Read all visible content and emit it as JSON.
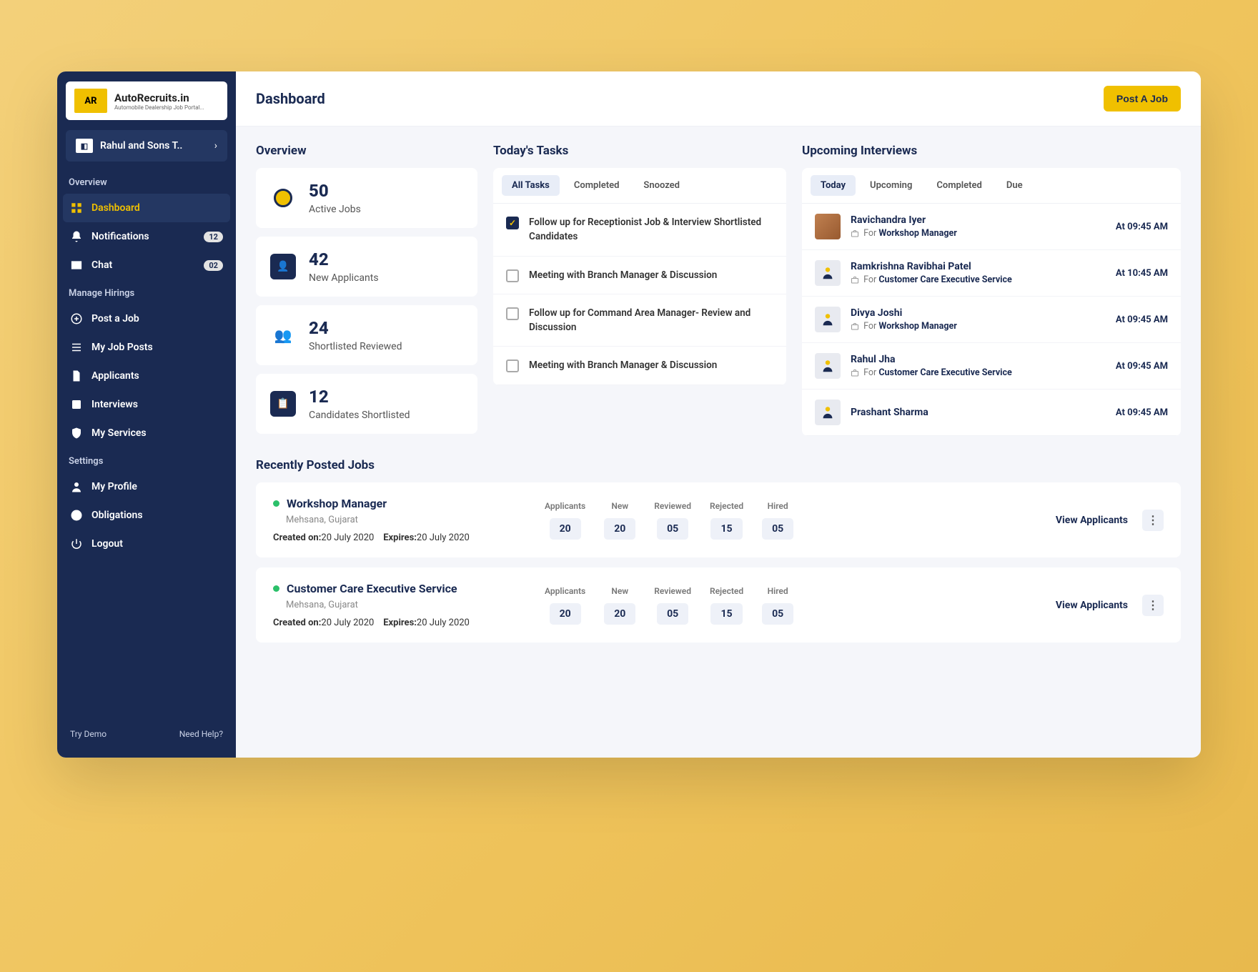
{
  "logo": {
    "brand": "AutoRecruits.in",
    "tagline": "Automobile Dealership Job Portal..."
  },
  "org": {
    "name": "Rahul and Sons T.."
  },
  "sidebar": {
    "sections": [
      {
        "label": "Overview",
        "items": [
          {
            "icon": "grid",
            "label": "Dashboard",
            "active": true
          },
          {
            "icon": "bell",
            "label": "Notifications",
            "badge": "12"
          },
          {
            "icon": "mail",
            "label": "Chat",
            "badge": "02"
          }
        ]
      },
      {
        "label": "Manage Hirings",
        "items": [
          {
            "icon": "plus-circle",
            "label": "Post a Job"
          },
          {
            "icon": "list",
            "label": "My Job Posts"
          },
          {
            "icon": "file",
            "label": "Applicants"
          },
          {
            "icon": "check-square",
            "label": "Interviews"
          },
          {
            "icon": "shield",
            "label": "My Services"
          }
        ]
      },
      {
        "label": "Settings",
        "items": [
          {
            "icon": "user",
            "label": "My Profile"
          },
          {
            "icon": "info",
            "label": "Obligations"
          },
          {
            "icon": "power",
            "label": "Logout"
          }
        ]
      }
    ],
    "footer": {
      "left": "Try Demo",
      "right": "Need Help?"
    }
  },
  "header": {
    "title": "Dashboard",
    "cta": "Post A Job"
  },
  "overview": {
    "title": "Overview",
    "stats": [
      {
        "value": "50",
        "label": "Active Jobs"
      },
      {
        "value": "42",
        "label": "New Applicants"
      },
      {
        "value": "24",
        "label": "Shortlisted Reviewed"
      },
      {
        "value": "12",
        "label": "Candidates Shortlisted"
      }
    ]
  },
  "tasks": {
    "title": "Today's Tasks",
    "tabs": [
      "All Tasks",
      "Completed",
      "Snoozed"
    ],
    "activeTab": 0,
    "items": [
      {
        "checked": true,
        "text": "Follow up for Receptionist Job & Interview Shortlisted Candidates"
      },
      {
        "checked": false,
        "text": "Meeting with Branch Manager & Discussion"
      },
      {
        "checked": false,
        "text": "Follow up for Command Area Manager- Review and Discussion"
      },
      {
        "checked": false,
        "text": "Meeting with Branch Manager & Discussion"
      }
    ]
  },
  "interviews": {
    "title": "Upcoming Interviews",
    "tabs": [
      "Today",
      "Upcoming",
      "Completed",
      "Due"
    ],
    "activeTab": 0,
    "forPrefix": "For",
    "items": [
      {
        "name": "Ravichandra Iyer",
        "role": "Workshop Manager",
        "time": "At 09:45 AM",
        "photo": true
      },
      {
        "name": "Ramkrishna Ravibhai Patel",
        "role": "Customer Care Executive Service",
        "time": "At 10:45 AM"
      },
      {
        "name": "Divya Joshi",
        "role": "Workshop Manager",
        "time": "At 09:45 AM"
      },
      {
        "name": "Rahul Jha",
        "role": "Customer Care Executive Service",
        "time": "At 09:45 AM"
      },
      {
        "name": "Prashant Sharma",
        "role": "",
        "time": "At 09:45 AM"
      }
    ]
  },
  "recentJobs": {
    "title": "Recently Posted Jobs",
    "createdLabel": "Created on:",
    "expiresLabel": "Expires:",
    "viewLabel": "View Applicants",
    "cols": [
      "Applicants",
      "New",
      "Reviewed",
      "Rejected",
      "Hired"
    ],
    "items": [
      {
        "title": "Workshop Manager",
        "location": "Mehsana, Gujarat",
        "created": "20 July 2020",
        "expires": "20 July 2020",
        "stats": [
          "20",
          "20",
          "05",
          "15",
          "05"
        ]
      },
      {
        "title": "Customer Care Executive Service",
        "location": "Mehsana, Gujarat",
        "created": "20 July 2020",
        "expires": "20 July 2020",
        "stats": [
          "20",
          "20",
          "05",
          "15",
          "05"
        ]
      }
    ]
  }
}
